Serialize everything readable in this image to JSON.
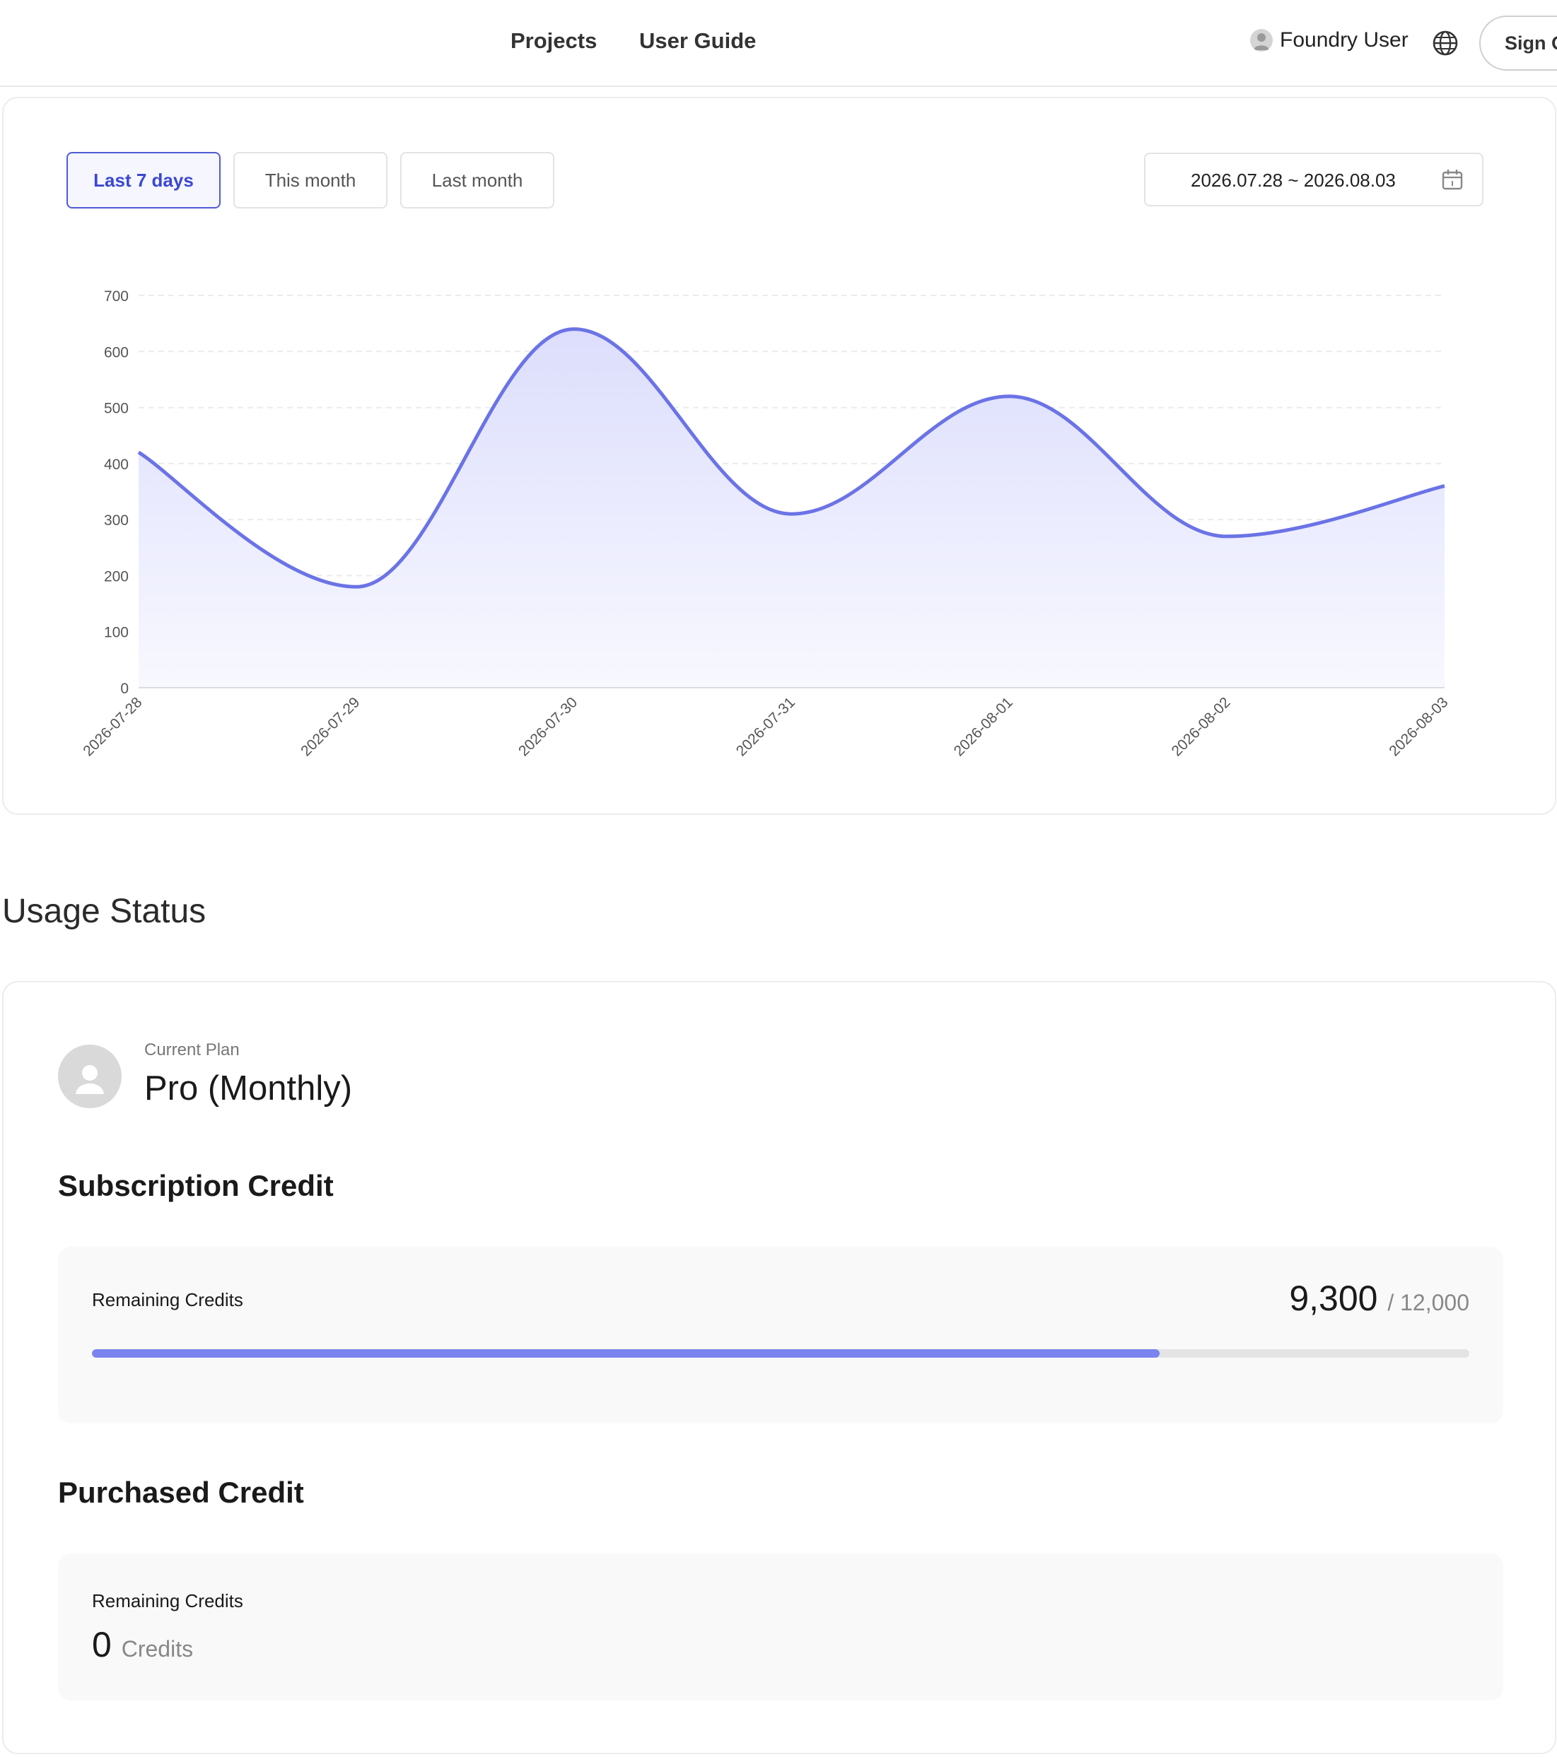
{
  "header": {
    "nav": [
      {
        "label": "Projects"
      },
      {
        "label": "User Guide"
      }
    ],
    "user_name": "Foundry User",
    "globe_icon": "globe-icon",
    "signout_label": "Sign Out"
  },
  "filters": {
    "ranges": [
      {
        "label": "Last 7 days",
        "active": true
      },
      {
        "label": "This month",
        "active": false
      },
      {
        "label": "Last month",
        "active": false
      }
    ],
    "date_range": "2026.07.28 ~ 2026.08.03",
    "calendar_icon": "calendar-icon"
  },
  "chart_data": {
    "type": "area",
    "categories": [
      "2026-07-28",
      "2026-07-29",
      "2026-07-30",
      "2026-07-31",
      "2026-08-01",
      "2026-08-02",
      "2026-08-03"
    ],
    "values": [
      420,
      180,
      640,
      310,
      520,
      270,
      360
    ],
    "ylim": [
      0,
      700
    ],
    "yticks": [
      0,
      100,
      200,
      300,
      400,
      500,
      600,
      700
    ],
    "grid": true,
    "smooth": true,
    "line_color": "#6b73e6",
    "fill_color_top": "#dcdefc",
    "fill_color_bottom": "#f8f8ff"
  },
  "usage": {
    "title": "Usage Status",
    "plan_label": "Current Plan",
    "plan_name": "Pro (Monthly)",
    "subscription": {
      "title": "Subscription Credit",
      "label": "Remaining Credits",
      "remaining": "9,300",
      "total": "/ 12,000",
      "fraction": 0.775
    },
    "purchased": {
      "title": "Purchased Credit",
      "label": "Remaining Credits",
      "value": "0",
      "unit": "Credits"
    }
  }
}
